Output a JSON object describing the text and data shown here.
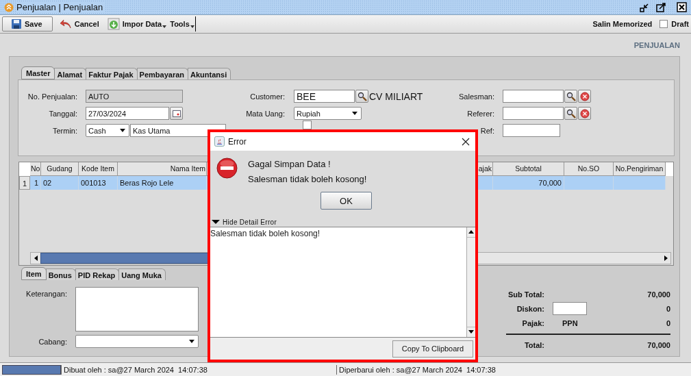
{
  "window": {
    "title": "Penjualan | Penjualan"
  },
  "toolbar": {
    "buttons": [
      {
        "label": "Save",
        "kind": "save",
        "dropdown": false
      },
      {
        "label": "Cancel",
        "kind": "cancel",
        "dropdown": false
      },
      {
        "label": "Impor Data",
        "kind": "import",
        "dropdown": true
      },
      {
        "label": "Tools",
        "kind": "menu",
        "dropdown": true
      }
    ],
    "memorized": "Salin Memorized",
    "draft": {
      "label": "Draft",
      "checked": false
    }
  },
  "heading": "PENJUALAN",
  "tabs": [
    {
      "label": "Master",
      "selected": true
    },
    {
      "label": "Alamat",
      "selected": false
    },
    {
      "label": "Faktur Pajak",
      "selected": false
    },
    {
      "label": "Pembayaran",
      "selected": false
    },
    {
      "label": "Akuntansi",
      "selected": false
    }
  ],
  "master": {
    "no_penjualan": {
      "label": "No. Penjualan:",
      "value": "AUTO"
    },
    "tanggal": {
      "label": "Tanggal:",
      "value": "27/03/2024"
    },
    "termin": {
      "label": "Termin:",
      "value": "Cash",
      "account": "Kas Utama"
    },
    "customer": {
      "label": "Customer:",
      "value": "BEE",
      "name": "CV MILIART"
    },
    "mata_uang": {
      "label": "Mata Uang:",
      "value": "Rupiah"
    },
    "checkbox": {
      "checked": false
    },
    "salesman": {
      "label": "Salesman:"
    },
    "referer": {
      "label": "Referer:"
    },
    "ref": {
      "label": "Ref:"
    }
  },
  "items_table": {
    "columns": [
      "No",
      "Gudang",
      "Kode Item",
      "Nama Item",
      "ajak",
      "Subtotal",
      "No.SO",
      "No.Pengiriman"
    ],
    "rows": [
      {
        "row_header": "1",
        "cells": [
          "1",
          "02",
          "001013",
          "Beras Rojo Lele",
          null,
          "70,000",
          null,
          null
        ],
        "selected": true
      }
    ]
  },
  "bottom_tabs": [
    {
      "label": "Item",
      "selected": true
    },
    {
      "label": "Bonus",
      "selected": false
    },
    {
      "label": "PID Rekap",
      "selected": false
    },
    {
      "label": "Uang Muka",
      "selected": false
    }
  ],
  "notes": {
    "keterangan": "Keterangan:",
    "cabang": "Cabang:"
  },
  "totals": {
    "sub_total": {
      "label": "Sub Total:",
      "value": "70,000"
    },
    "diskon": {
      "label": "Diskon:",
      "value": "0"
    },
    "pajak": {
      "label": "Pajak:",
      "tax": "PPN",
      "value": "0"
    },
    "total": {
      "label": "Total:",
      "value": "70,000"
    }
  },
  "status_bar": {
    "created": "Dibuat oleh : sa@27 March 2024  14:07:38",
    "updated": "Diperbarui oleh : sa@27 March 2024  14:07:38"
  },
  "dialog": {
    "title": "Error",
    "kind": "error",
    "messages": [
      "Gagal Simpan Data !",
      "Salesman tidak boleh kosong!"
    ],
    "ok": "OK",
    "detail_toggle": {
      "label": "Hide Detail Error",
      "expanded": true
    },
    "detail": "Salesman tidak boleh kosong!",
    "copy": {
      "label": "Copy To Clipboard"
    }
  }
}
